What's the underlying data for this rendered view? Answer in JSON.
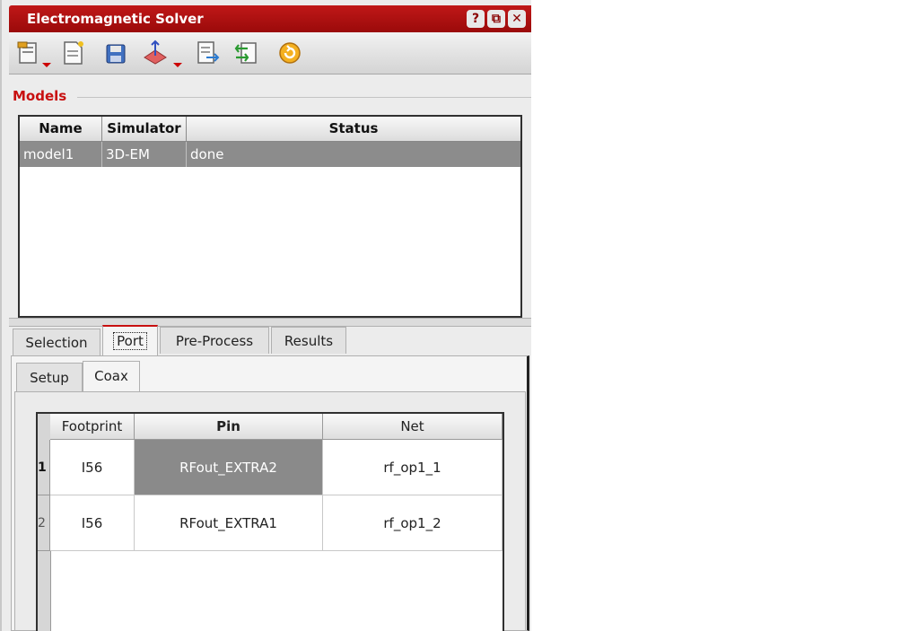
{
  "window": {
    "title": "Electromagnetic Solver",
    "buttons": {
      "help": "?",
      "restore": "⧉",
      "close": "✕"
    }
  },
  "toolbar": {
    "icons": [
      "properties-icon",
      "new-document-icon",
      "save-icon",
      "transform-icon",
      "export-icon",
      "import-icon",
      "refresh-icon"
    ]
  },
  "models": {
    "section_title": "Models",
    "columns": [
      "Name",
      "Simulator",
      "Status"
    ],
    "rows": [
      {
        "name": "model1",
        "simulator": "3D-EM",
        "status": "done"
      }
    ]
  },
  "tabs": {
    "outer": [
      "Selection",
      "Port",
      "Pre-Process",
      "Results"
    ],
    "outer_active": "Port",
    "inner": [
      "Setup",
      "Coax"
    ],
    "inner_active": "Coax"
  },
  "port_grid": {
    "columns": [
      "Footprint",
      "Pin",
      "Net"
    ],
    "rows": [
      {
        "index": "1",
        "footprint": "I56",
        "pin": "RFout_EXTRA2",
        "net": "rf_op1_1"
      },
      {
        "index": "2",
        "footprint": "I56",
        "pin": "RFout_EXTRA1",
        "net": "rf_op1_2"
      }
    ]
  },
  "colors": {
    "accent": "#c81010",
    "selected_row": "#8c8c8c"
  }
}
